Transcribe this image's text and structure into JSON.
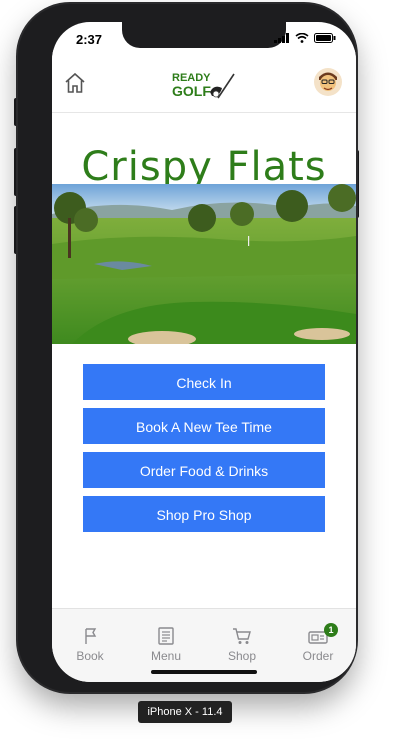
{
  "status_bar": {
    "time": "2:37"
  },
  "header": {
    "logo_line1": "READY",
    "logo_line2": "GOLF"
  },
  "venue": {
    "name": "Crispy Flats"
  },
  "actions": [
    {
      "label": "Check In"
    },
    {
      "label": "Book A New Tee Time"
    },
    {
      "label": "Order Food & Drinks"
    },
    {
      "label": "Shop Pro Shop"
    }
  ],
  "tabbar": {
    "items": [
      {
        "label": "Book",
        "icon": "flag-icon"
      },
      {
        "label": "Menu",
        "icon": "menu-icon"
      },
      {
        "label": "Shop",
        "icon": "cart-icon"
      },
      {
        "label": "Order",
        "icon": "order-icon",
        "badge": "1"
      }
    ]
  },
  "device_label": "iPhone X - 11.4",
  "colors": {
    "accent": "#3478f6",
    "brand_green": "#2e7d1a"
  }
}
